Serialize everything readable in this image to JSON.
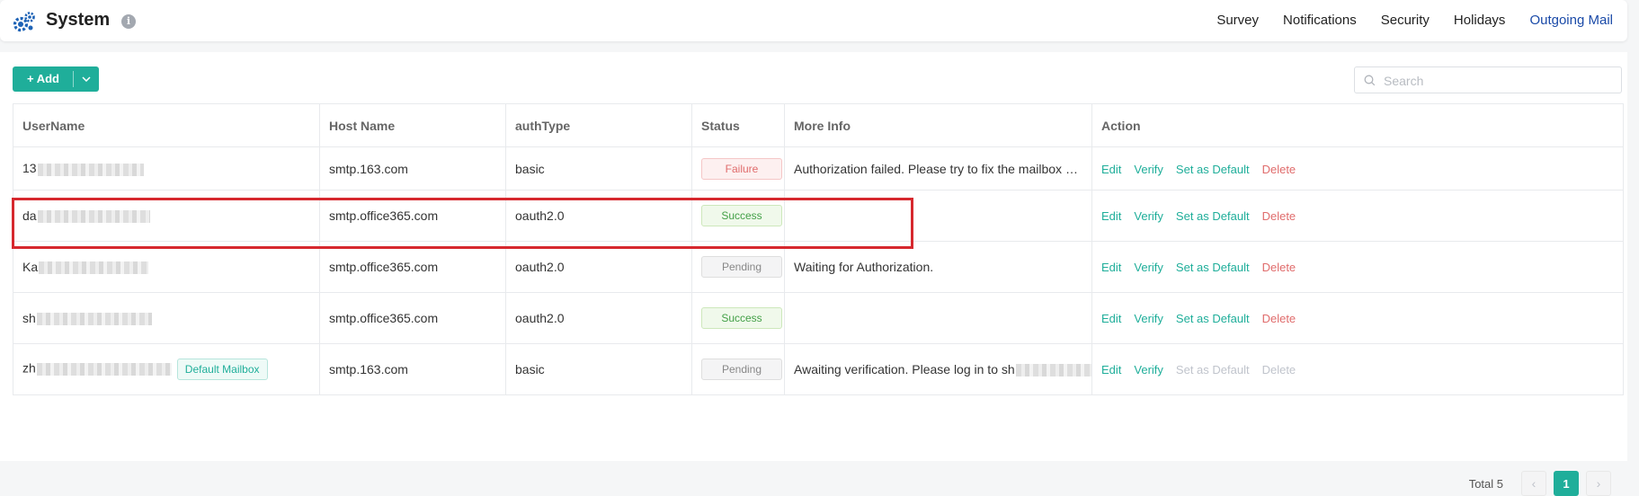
{
  "header": {
    "title": "System",
    "info_icon": "info-icon",
    "nav": [
      "Survey",
      "Notifications",
      "Security",
      "Holidays",
      "Outgoing Mail"
    ],
    "active_nav": "Outgoing Mail"
  },
  "toolbar": {
    "add_label": "+ Add",
    "search_placeholder": "Search"
  },
  "table": {
    "columns": [
      "UserName",
      "Host Name",
      "authType",
      "Status",
      "More Info",
      "Action"
    ],
    "rows": [
      {
        "username": "13",
        "host": "smtp.163.com",
        "auth": "basic",
        "status": "Failure",
        "info": "Authorization failed. Please try to fix the mailbox configuration."
      },
      {
        "username": "da",
        "host": "smtp.office365.com",
        "auth": "oauth2.0",
        "status": "Success",
        "info": ""
      },
      {
        "username": "Ka",
        "host": "smtp.office365.com",
        "auth": "oauth2.0",
        "status": "Pending",
        "info": "Waiting for Authorization."
      },
      {
        "username": "sh",
        "host": "smtp.office365.com",
        "auth": "oauth2.0",
        "status": "Success",
        "info": ""
      },
      {
        "username": "zh",
        "host": "smtp.163.com",
        "auth": "basic",
        "status": "Pending",
        "info": "Awaiting verification. Please log in to sh",
        "badge": "Default Mailbox"
      }
    ],
    "actions": {
      "edit": "Edit",
      "verify": "Verify",
      "set_default": "Set as Default",
      "delete": "Delete"
    }
  },
  "pagination": {
    "total_label": "Total 5",
    "current_page": "1"
  },
  "colors": {
    "accent": "#1fae9a",
    "nav_active": "#1a4aa8",
    "danger": "#e06c6c",
    "success": "#43a047",
    "highlight": "#d6282e"
  }
}
